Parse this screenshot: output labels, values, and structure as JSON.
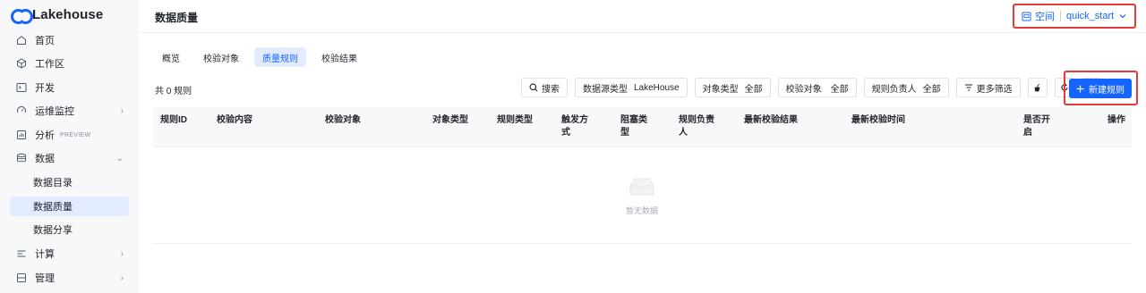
{
  "brand": {
    "name": "Lakehouse",
    "accent": "#1664ff"
  },
  "sidebar": {
    "items": [
      {
        "label": "首页",
        "icon": "home-icon"
      },
      {
        "label": "工作区",
        "icon": "cube-icon"
      },
      {
        "label": "开发",
        "icon": "terminal-icon"
      },
      {
        "label": "运维监控",
        "icon": "monitor-icon",
        "chevron": "›"
      },
      {
        "label": "分析",
        "icon": "analysis-icon",
        "badge": "PREVIEW"
      },
      {
        "label": "数据",
        "icon": "database-icon",
        "chevron": "⌄"
      },
      {
        "label": "计算",
        "icon": "compute-icon",
        "chevron": "›"
      },
      {
        "label": "管理",
        "icon": "manage-icon",
        "chevron": "›"
      }
    ],
    "sub_items": [
      {
        "label": "数据目录"
      },
      {
        "label": "数据质量",
        "active": true
      },
      {
        "label": "数据分享"
      }
    ]
  },
  "header": {
    "title": "数据质量",
    "space_label": "空间",
    "space_value": "quick_start"
  },
  "tabs": [
    {
      "label": "概览"
    },
    {
      "label": "校验对象"
    },
    {
      "label": "质量规则",
      "active": true
    },
    {
      "label": "校验结果"
    }
  ],
  "toolbar": {
    "count_text": "共 0 规则",
    "search_label": "搜索",
    "filters": [
      {
        "label": "数据源类型",
        "value": "LakeHouse"
      },
      {
        "label": "对象类型",
        "value": "全部"
      },
      {
        "label": "校验对象",
        "value": "全部"
      },
      {
        "label": "规则负责人",
        "value": "全部"
      }
    ],
    "more_filters_label": "更多筛选",
    "new_rule_label": "新建规则"
  },
  "table": {
    "columns": [
      {
        "label": "规则ID"
      },
      {
        "label": "校验内容"
      },
      {
        "label": "校验对象"
      },
      {
        "label": "对象类型"
      },
      {
        "label": "规则类型"
      },
      {
        "label": "触发方\n式"
      },
      {
        "label": "阻塞类\n型"
      },
      {
        "label": "规则负责\n人"
      },
      {
        "label": "最新校验结果"
      },
      {
        "label": "最新校验时间"
      },
      {
        "label": "是否开\n启"
      },
      {
        "label": "操作"
      }
    ],
    "empty_text": "暂无数据"
  }
}
